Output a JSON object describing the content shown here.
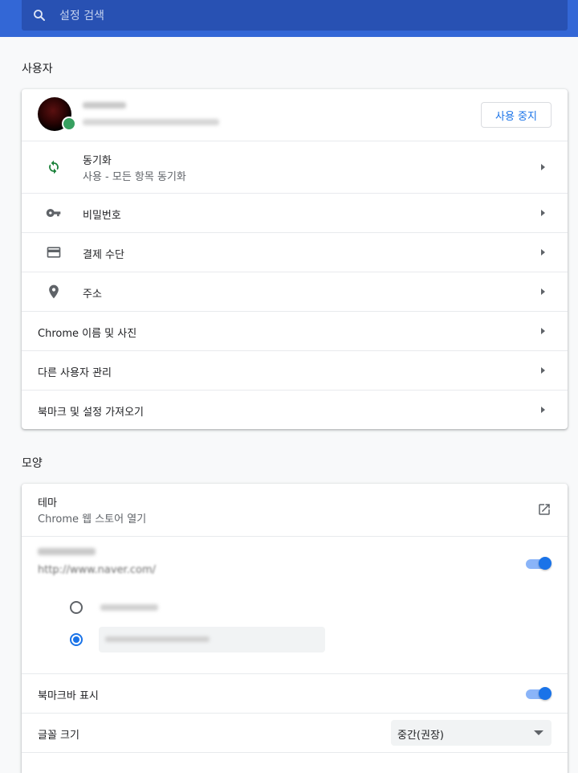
{
  "search": {
    "placeholder": "설정 검색",
    "icon": "search-icon"
  },
  "people": {
    "title": "사용자",
    "stop_sync_label": "사용 중지",
    "sync": {
      "title": "동기화",
      "subtitle": "사용 - 모든 항목 동기화"
    },
    "passwords": {
      "label": "비밀번호"
    },
    "payments": {
      "label": "결제 수단"
    },
    "addresses": {
      "label": "주소"
    },
    "chrome_name": {
      "label": "Chrome 이름 및 사진"
    },
    "manage_people": {
      "label": "다른 사용자 관리"
    },
    "import": {
      "label": "북마크 및 설정 가져오기"
    }
  },
  "appearance": {
    "title": "모양",
    "theme": {
      "title": "테마",
      "subtitle": "Chrome 웹 스토어 열기"
    },
    "home_button": {
      "url": "http://www.naver.com/",
      "enabled": true
    },
    "bookmarks_bar": {
      "label": "북마크바 표시",
      "enabled": true
    },
    "font_size": {
      "label": "글꼴 크기",
      "value": "중간(권장)"
    }
  },
  "colors": {
    "accent": "#1a73e8",
    "header": "#3367d6",
    "sync_green": "#188038"
  }
}
